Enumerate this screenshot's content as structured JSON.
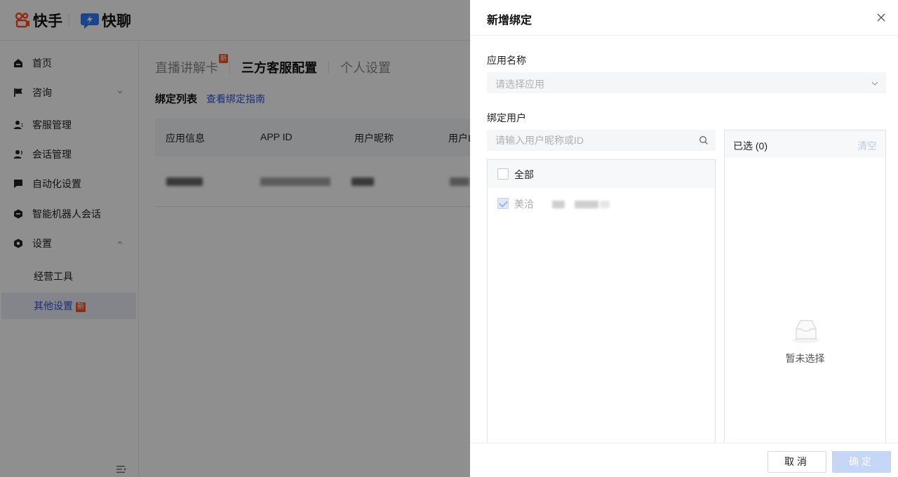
{
  "header": {
    "logo_kuaishou": "快手",
    "logo_kuailiao": "快聊"
  },
  "sidebar": {
    "items": [
      {
        "label": "首页",
        "icon": "home-icon"
      },
      {
        "label": "咨询",
        "icon": "flag-icon",
        "expand": "collapsed"
      },
      {
        "label": "客服管理",
        "icon": "user-icon"
      },
      {
        "label": "会话管理",
        "icon": "user-chat-icon"
      },
      {
        "label": "自动化设置",
        "icon": "chat-icon"
      },
      {
        "label": "智能机器人会话",
        "icon": "robot-icon"
      },
      {
        "label": "设置",
        "icon": "settings-icon",
        "expand": "expanded"
      }
    ],
    "sub_items": [
      {
        "label": "经营工具"
      },
      {
        "label": "其他设置",
        "badge": "新",
        "active": true
      }
    ]
  },
  "main": {
    "tabs": [
      {
        "label": "直播讲解卡",
        "badge": "新"
      },
      {
        "label": "三方客服配置",
        "active": true
      },
      {
        "label": "个人设置"
      }
    ],
    "list_title": "绑定列表",
    "list_link": "查看绑定指南",
    "table_headers": [
      "应用信息",
      "APP ID",
      "用户昵称",
      "用户I"
    ]
  },
  "drawer": {
    "title": "新增绑定",
    "app_name_label": "应用名称",
    "app_select_placeholder": "请选择应用",
    "bind_user_label": "绑定用户",
    "search_placeholder": "请输入用户昵称或ID",
    "select_all_label": "全部",
    "users": [
      {
        "name": "美洽",
        "checked": true,
        "disabled": true
      }
    ],
    "selected_title": "已选 (0)",
    "clear_label": "清空",
    "empty_text": "暂未选择",
    "cancel_label": "取消",
    "confirm_label": "确定"
  },
  "colors": {
    "accent": "#2f54d9",
    "badge": "#f05a28",
    "confirm_disabled": "#c5d6f7",
    "overlay": "rgba(0,0,0,0.44)"
  }
}
